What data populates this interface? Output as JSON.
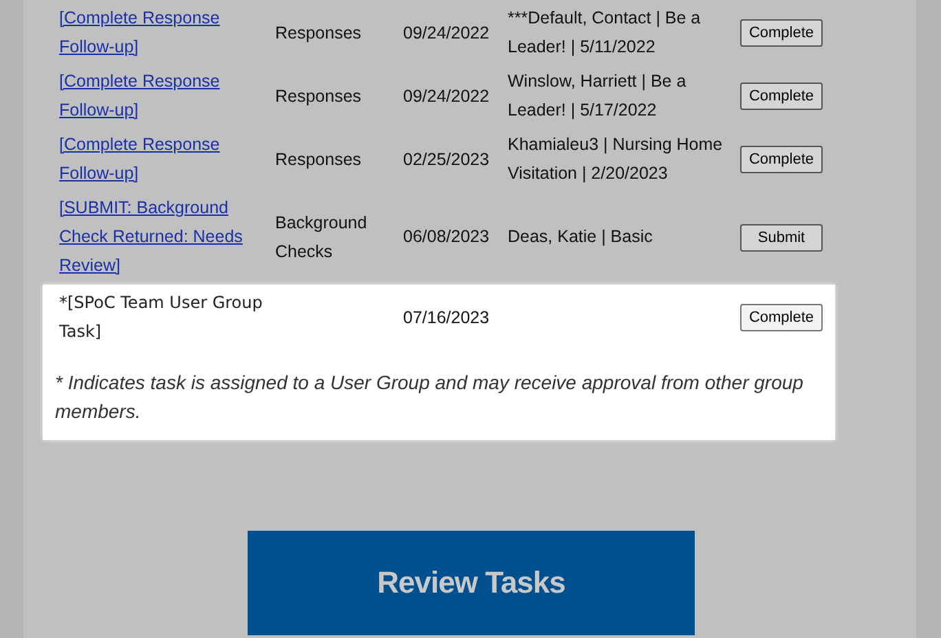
{
  "tasks": [
    {
      "title": "[Complete Response Follow-up]",
      "category": "Responses",
      "date": "09/24/2022",
      "details": "***Default, Contact | Be a Leader! | 5/11/2022",
      "action": "Complete"
    },
    {
      "title": "[Complete Response Follow-up]",
      "category": "Responses",
      "date": "09/24/2022",
      "details": "Winslow, Harriett | Be a Leader! | 5/17/2022",
      "action": "Complete"
    },
    {
      "title": "[Complete Response Follow-up]",
      "category": "Responses",
      "date": "02/25/2023",
      "details": "Khamialeu3 | Nursing Home Visitation | 2/20/2023",
      "action": "Complete"
    },
    {
      "title": "[SUBMIT: Background Check Returned: Needs Review]",
      "category": "Background Checks",
      "date": "06/08/2023",
      "details": "Deas, Katie | Basic",
      "action": "Submit"
    }
  ],
  "group_panel": {
    "tasks": [
      {
        "title": "*[SPoC Team User Group Task]",
        "date": "07/16/2023",
        "action": "Complete"
      }
    ],
    "note": "* Indicates task is assigned to a User Group and may receive approval from other group members."
  },
  "review_button": "Review Tasks"
}
